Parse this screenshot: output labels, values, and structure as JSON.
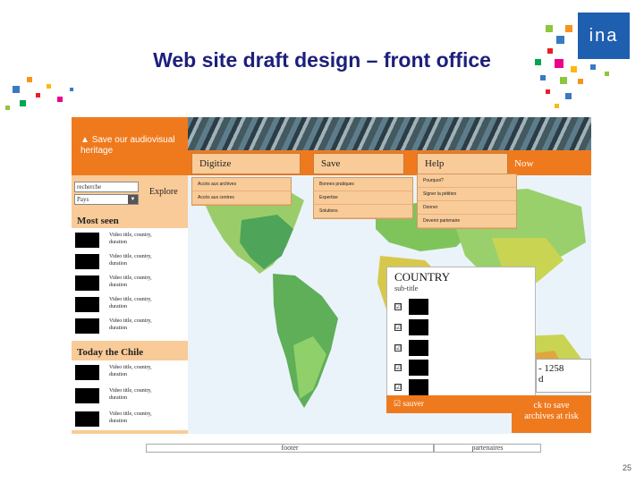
{
  "slide": {
    "title": "Web site draft design – front office",
    "logo_text": "ina",
    "page_number": "25"
  },
  "header": {
    "tagline": "Save our audiovisual heritage",
    "search_value": "recherche",
    "country_value": "Pays",
    "explore_label": "Explore"
  },
  "nav": {
    "tabs": [
      {
        "label": "Digitize",
        "items": [
          "Accès aux archives",
          "Accès aux centres"
        ]
      },
      {
        "label": "Save",
        "items": [
          "Bonnes pratiques",
          "Expertise",
          "Solutions"
        ]
      },
      {
        "label": "Help",
        "items": [
          "Pourquoi?",
          "Signer la pétition",
          "Donner",
          "Devenir partenaire"
        ]
      }
    ],
    "now_label": "Now"
  },
  "most_seen": {
    "heading": "Most seen",
    "items": [
      {
        "line1": "Video title, country,",
        "line2": "duration"
      },
      {
        "line1": "Video title, country,",
        "line2": "duration"
      },
      {
        "line1": "Video title, country,",
        "line2": "duration"
      },
      {
        "line1": "Video title, country,",
        "line2": "duration"
      },
      {
        "line1": "Video title, country,",
        "line2": "duration"
      }
    ]
  },
  "today": {
    "heading": "Today the Chile",
    "items": [
      {
        "line1": "Video title, country,",
        "line2": "duration"
      },
      {
        "line1": "Video title, country,",
        "line2": "duration"
      },
      {
        "line1": "Video title, country,",
        "line2": "duration"
      }
    ]
  },
  "country_panel": {
    "title": "COUNTRY",
    "subtitle": "sub-title",
    "checkbox_count": 5,
    "checkbox_glyph": "☑",
    "save_label": "sauver"
  },
  "right_box": {
    "line1": "- 1258",
    "line2": "d"
  },
  "click_box": {
    "line1": "ck to save",
    "line2": "archives at risk"
  },
  "footer": {
    "label": "footer",
    "partners_label": "partenaires"
  },
  "colors": {
    "accent": "#ef7a1e",
    "panel": "#f9cb98",
    "title": "#1c1f7a"
  }
}
